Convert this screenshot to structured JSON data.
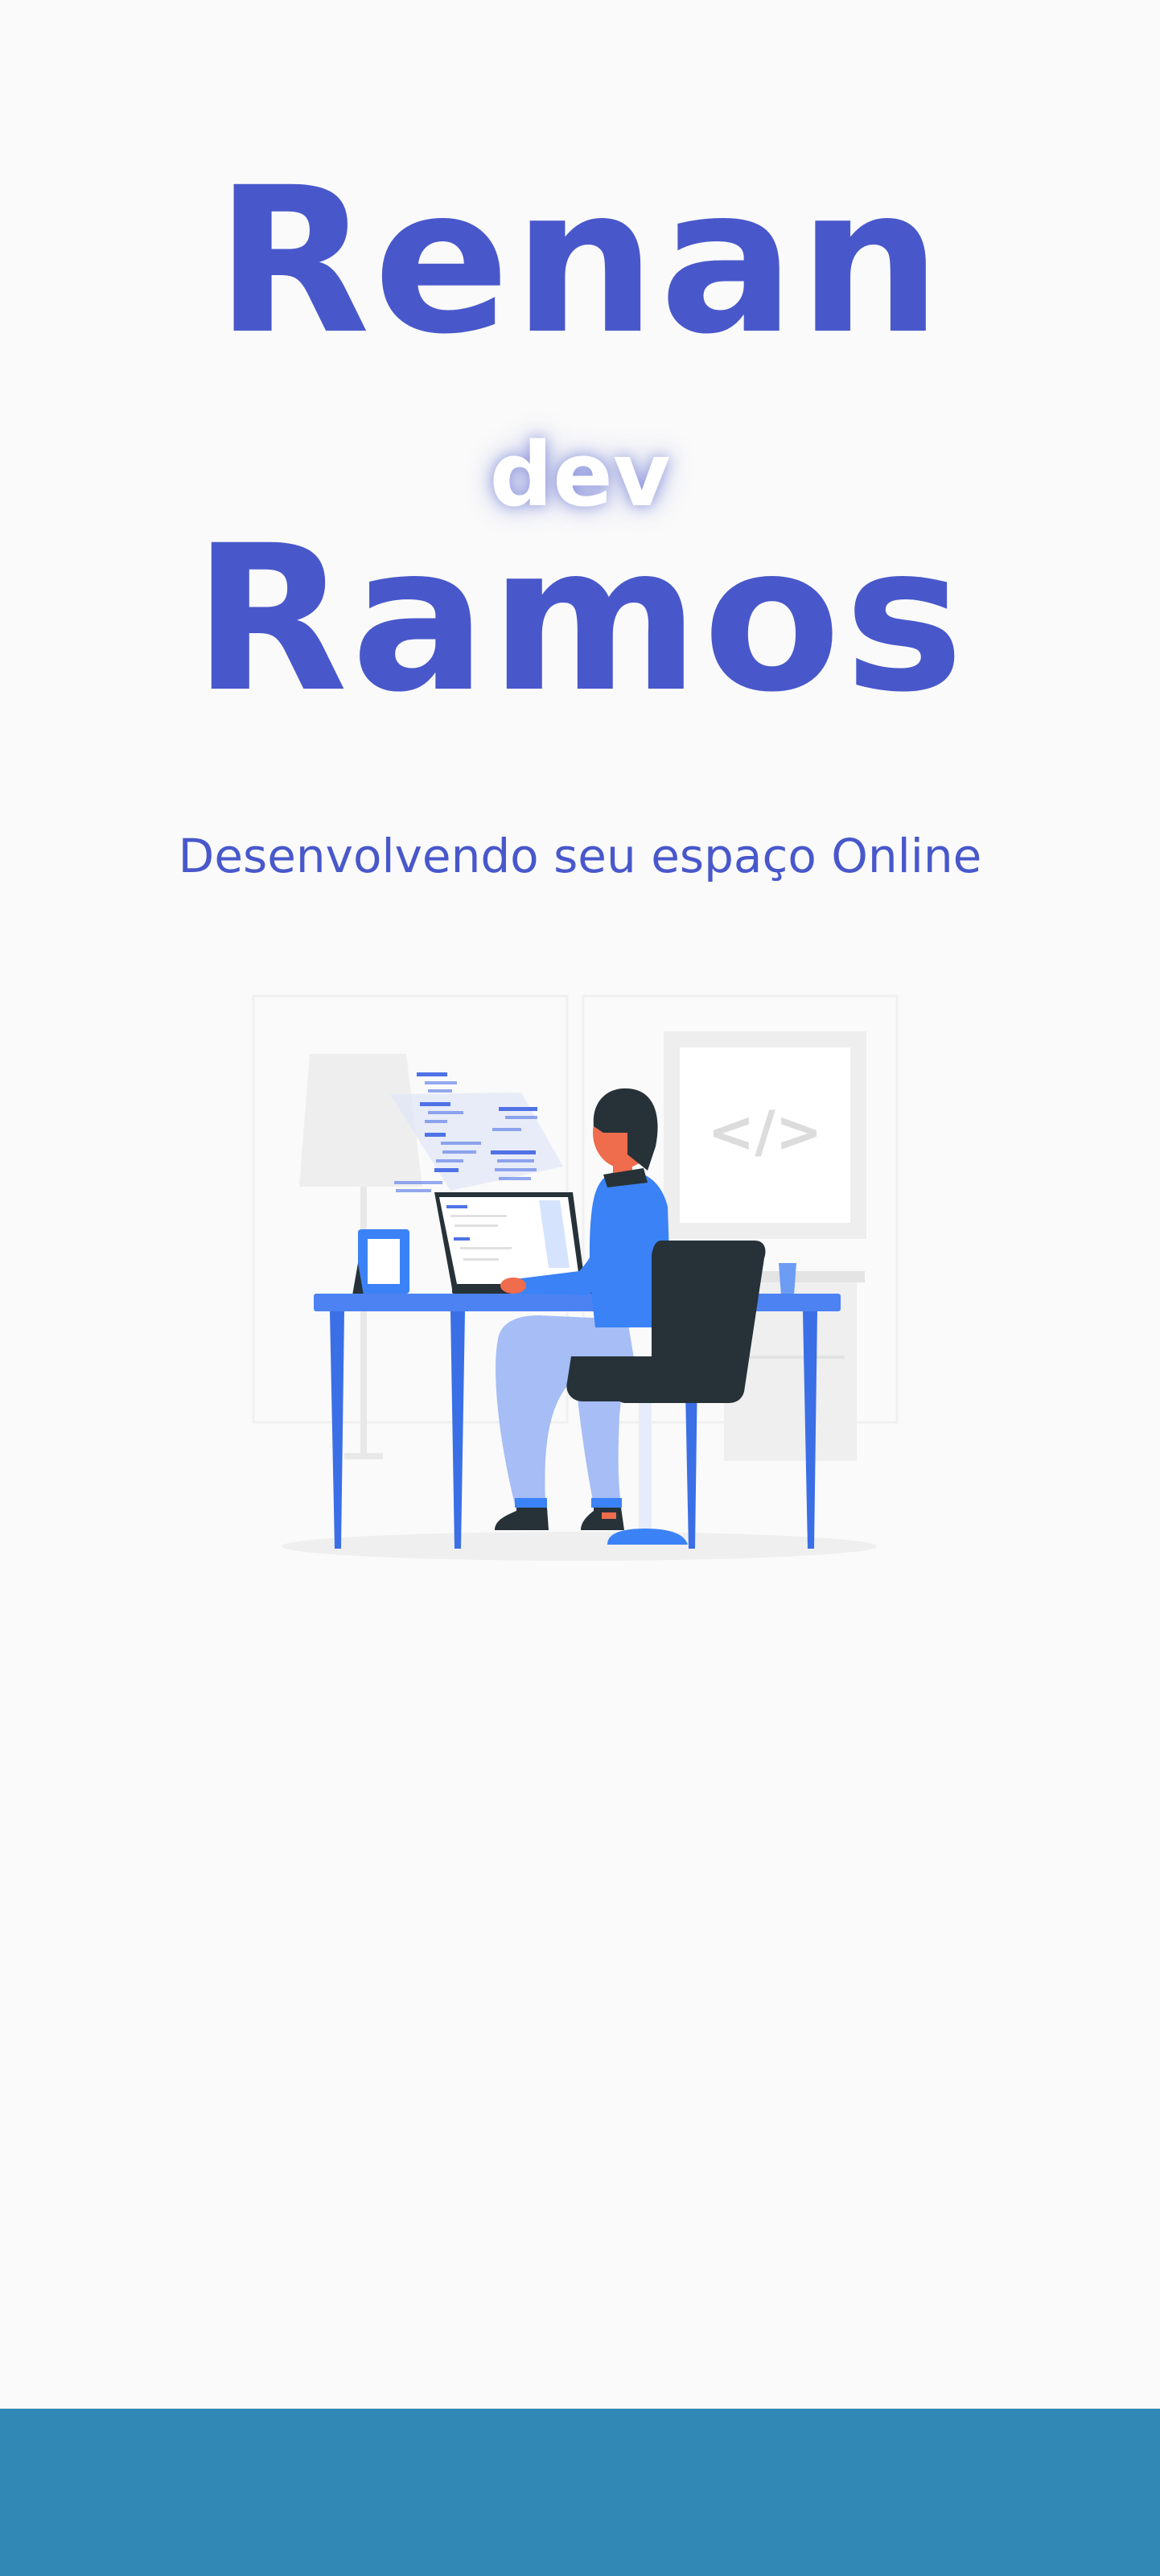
{
  "hero": {
    "name_first": "Renan",
    "name_middle": "dev",
    "name_last": "Ramos",
    "tagline": "Desenvolvendo seu espaço Online"
  },
  "illustration": {
    "code_symbol": "</>",
    "icon": "developer-at-desk-illustration"
  },
  "colors": {
    "background": "#fafafa",
    "title": "#4858cb",
    "accent_blue": "#3b82f6",
    "footer": "#3288b5",
    "dark": "#263238"
  }
}
